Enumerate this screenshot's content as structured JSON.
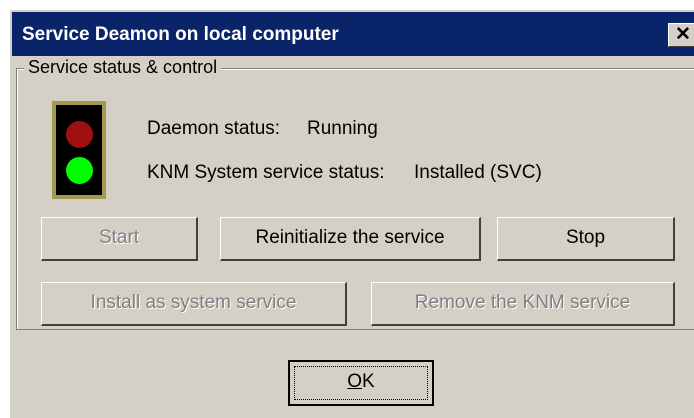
{
  "window": {
    "title": "Service Deamon on local computer",
    "close_glyph": "✕"
  },
  "group": {
    "legend": "Service status & control"
  },
  "traffic_light": {
    "red_color": "#a01010",
    "green_color": "#00ff00",
    "active": "green"
  },
  "status": {
    "daemon_label": "Daemon status:",
    "daemon_value": "Running",
    "knm_label": "KNM System service status:",
    "knm_value": "Installed (SVC)"
  },
  "buttons": {
    "start": "Start",
    "reinitialize": "Reinitialize the service",
    "stop": "Stop",
    "install": "Install as system service",
    "remove": "Remove the KNM service",
    "ok_mnemonic": "O",
    "ok_rest": "K"
  },
  "colors": {
    "titlebar": "#0a246a",
    "face": "#d4d0c8",
    "disabled_text": "#808080"
  }
}
